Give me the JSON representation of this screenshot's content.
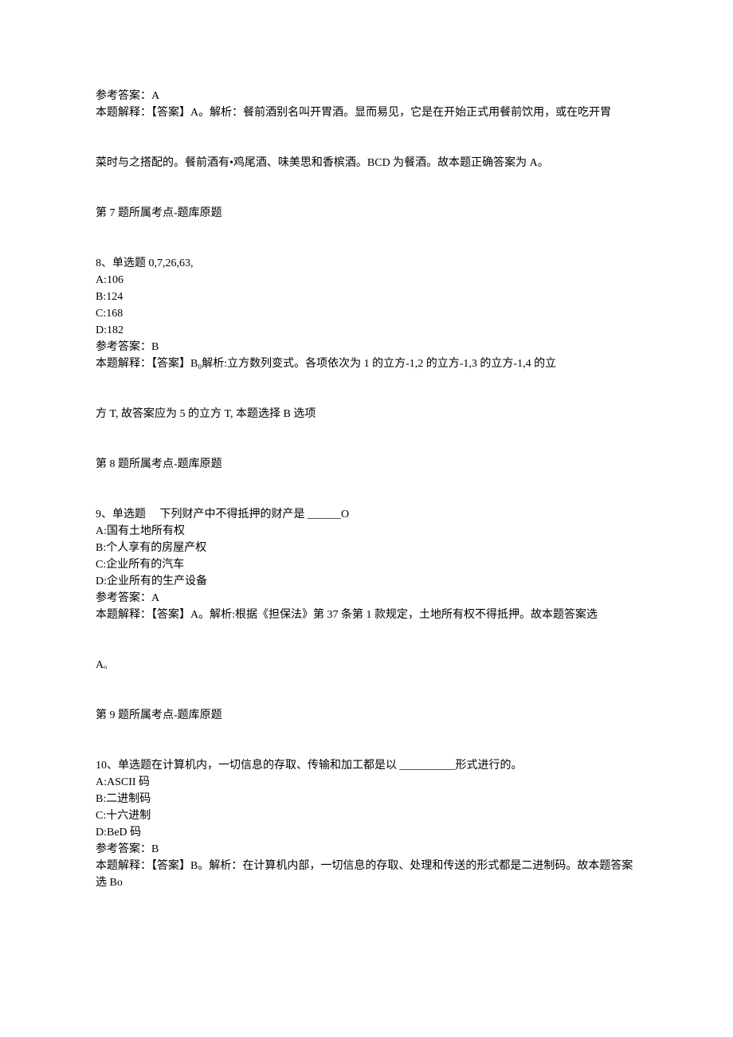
{
  "q7_answer_label": "参考答案：A",
  "q7_explain_line1": "本题解释：【答案】A。解析：餐前酒别名叫开胃酒。显而易见，它是在开始正式用餐前饮用，或在吃开胃",
  "q7_explain_line2": "菜时与之搭配的。餐前酒有•鸡尾酒、味美思和香槟酒。BCD 为餐酒。故本题正确答案为 A。",
  "q7_topic": "第 7 题所属考点-题库原题",
  "q8_title": "8、单选题 0,7,26,63,",
  "q8_opt_a": "A:106",
  "q8_opt_b": "B:124",
  "q8_opt_c": "C:168",
  "q8_opt_d": "D:182",
  "q8_answer_label": "参考答案：B",
  "q8_explain_line1": "本题解释：【答案】B₀解析:立方数列变式。各项依次为 1 的立方-1,2 的立方-1,3 的立方-1,4 的立",
  "q8_explain_line2": "方 T, 故答案应为 5 的立方 T, 本题选择 B 选项",
  "q8_topic": "第 8 题所属考点-题库原题",
  "q9_title": "9、单选题　 下列财产中不得抵押的财产是 ______O",
  "q9_opt_a": "A:国有土地所有权",
  "q9_opt_b": "B:个人享有的房屋产权",
  "q9_opt_c": "C:企业所有的汽车",
  "q9_opt_d": "D:企业所有的生产设备",
  "q9_answer_label": "参考答案：A",
  "q9_explain_line1": "本题解释：【答案】A。解析:根据《担保法》第 37 条第 1 款规定，土地所有权不得抵押。故本题答案选",
  "q9_explain_line2": "Aₒ",
  "q9_topic": "第 9 题所属考点-题库原题",
  "q10_title": "10、单选题在计算机内，一切信息的存取、传输和加工都是以 __________形式进行的。",
  "q10_opt_a": "A:ASCII 码",
  "q10_opt_b": "B:二进制码",
  "q10_opt_c": "C:十六进制",
  "q10_opt_d": "D:BeD 码",
  "q10_answer_label": "参考答案：B",
  "q10_explain_line1": "本题解释：【答案】B。解析：在计算机内部，一切信息的存取、处理和传送的形式都是二进制码。故本题答案",
  "q10_explain_line2": "选 Bo"
}
